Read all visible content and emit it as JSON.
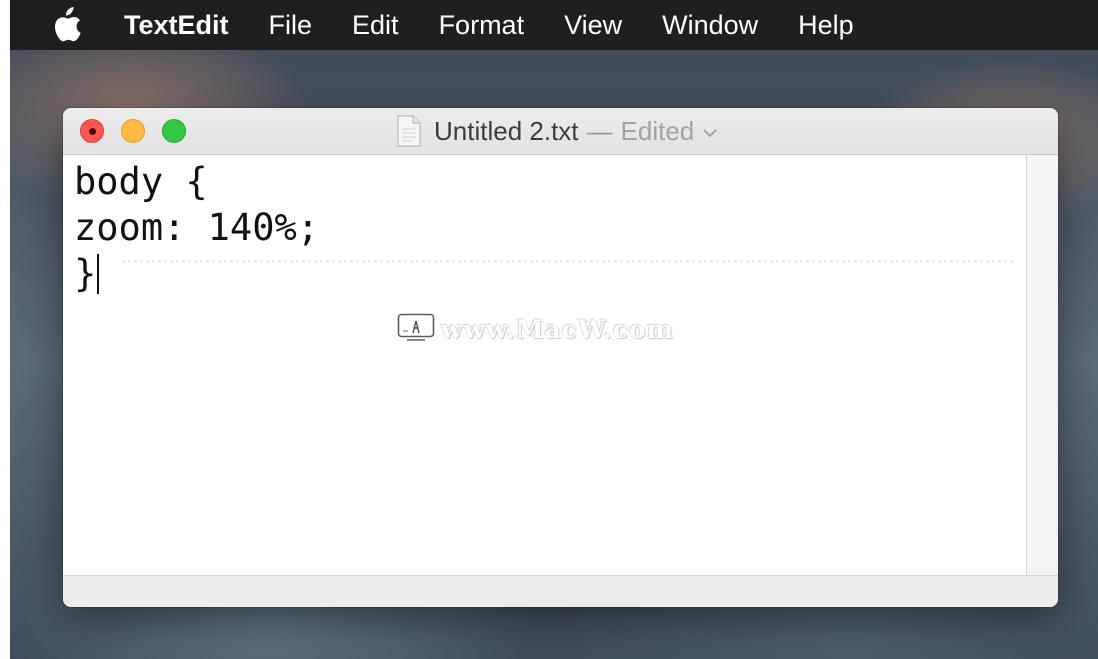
{
  "menubar": {
    "apple_icon": "apple-logo-icon",
    "app_name": "TextEdit",
    "items": [
      "File",
      "Edit",
      "Format",
      "View",
      "Window",
      "Help"
    ]
  },
  "window": {
    "title": "Untitled 2.txt",
    "separator": "—",
    "status": "Edited",
    "document_icon": "text-document-icon",
    "title_menu_icon": "chevron-down-icon",
    "buttons": {
      "close_color": "#fc5753",
      "minimize_color": "#fdbc40",
      "zoom_color": "#33c748"
    }
  },
  "editor": {
    "lines": [
      "body {",
      "zoom: 140%;",
      "}"
    ]
  },
  "watermark": {
    "text": "www.MacW.com"
  }
}
